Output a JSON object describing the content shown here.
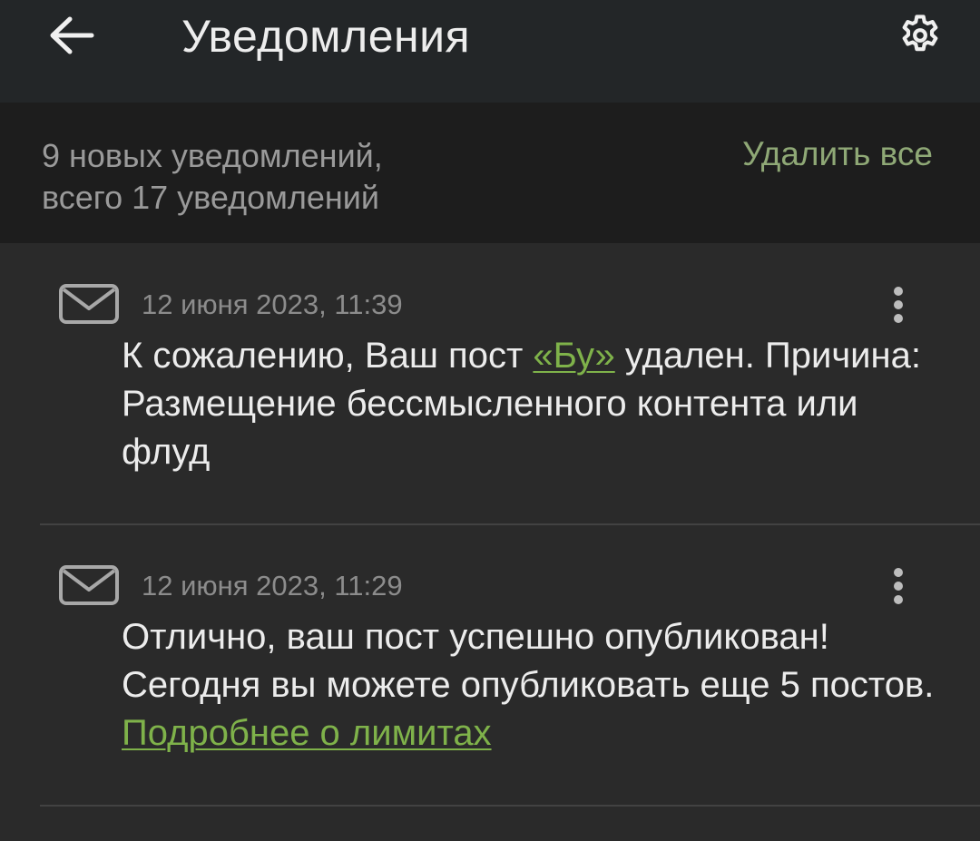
{
  "header": {
    "title": "Уведомления",
    "back_icon": "arrow-left-icon",
    "settings_icon": "gear-icon"
  },
  "summary": {
    "line1": "9 новых уведомлений,",
    "line2": "всего 17 уведомлений",
    "delete_all": "Удалить все"
  },
  "notifications": [
    {
      "timestamp": "12 июня 2023, 11:39",
      "text_before": "К сожалению, Ваш пост ",
      "link_text": "«Бу»",
      "text_after": " удален. Причина: Размещение бессмысленного контента или флуд",
      "icon": "envelope-icon"
    },
    {
      "timestamp": "12 июня 2023, 11:29",
      "text_before": "Отлично, ваш пост успешно опубликован! Сегодня вы можете опубликовать еще 5 постов. ",
      "link_text": "Подробнее о лимитах",
      "text_after": "",
      "icon": "envelope-icon"
    }
  ],
  "colors": {
    "accent_link": "#7fb24a",
    "delete_all": "#8fa876",
    "header_bg": "#232628",
    "summary_bg": "#1d1d1d",
    "list_bg": "#2a2a2a"
  }
}
